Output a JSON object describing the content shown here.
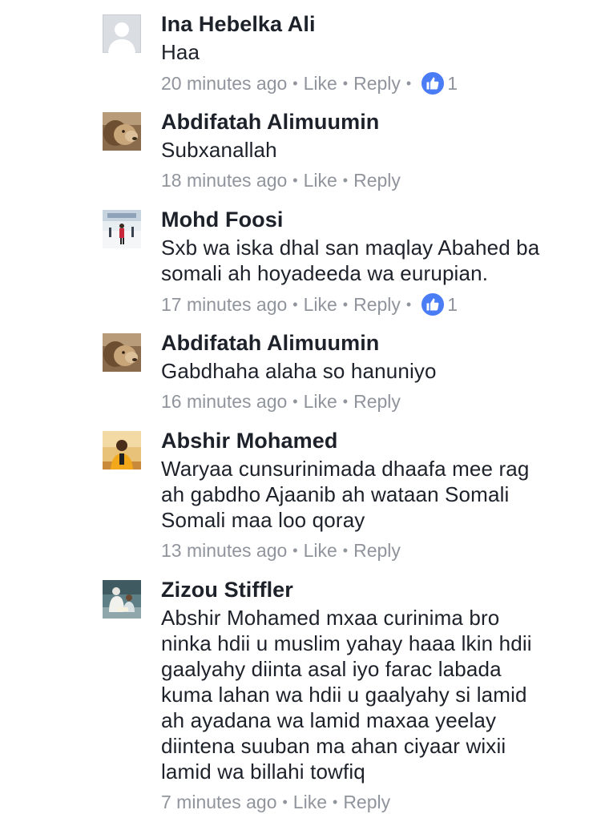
{
  "comments": [
    {
      "author": "Ina Hebelka Ali",
      "avatar": "default-profile-icon",
      "lines": [
        "Haa"
      ],
      "time": "20 minutes ago",
      "like_label": "Like",
      "reply_label": "Reply",
      "reaction_count": "1"
    },
    {
      "author": "Abdifatah Alimuumin",
      "avatar": "lion-photo",
      "lines": [
        "Subxanallah"
      ],
      "time": "18 minutes ago",
      "like_label": "Like",
      "reply_label": "Reply"
    },
    {
      "author": "Mohd Foosi",
      "avatar": "snow-street-photo",
      "lines": [
        "Sxb wa iska dhal san maqlay Abahed ba",
        "somali ah hoyadeeda wa eurupian."
      ],
      "time": "17 minutes ago",
      "like_label": "Like",
      "reply_label": "Reply",
      "reaction_count": "1"
    },
    {
      "author": "Abdifatah Alimuumin",
      "avatar": "lion-photo",
      "lines": [
        "Gabdhaha alaha so hanuniyo"
      ],
      "time": "16 minutes ago",
      "like_label": "Like",
      "reply_label": "Reply"
    },
    {
      "author": "Abshir Mohamed",
      "avatar": "portrait-photo",
      "lines": [
        "Waryaa cunsurinimada dhaafa mee rag",
        "ah gabdho Ajaanib ah wataan Somali",
        "Somali maa loo qoray"
      ],
      "time": "13 minutes ago",
      "like_label": "Like",
      "reply_label": "Reply"
    },
    {
      "author": "Zizou Stiffler",
      "avatar": "reading-photo",
      "lines": [
        "Abshir Mohamed mxaa curinima bro",
        "ninka hdii u muslim yahay haaa lkin hdii",
        "gaalyahy diinta asal iyo farac labada",
        "kuma lahan wa hdii u gaalyahy si lamid",
        "ah ayadana wa lamid maxaa yeelay",
        "diintena suuban ma ahan ciyaar wixii",
        "lamid wa billahi towfiq"
      ],
      "time": "7 minutes ago",
      "like_label": "Like",
      "reply_label": "Reply"
    }
  ],
  "colors": {
    "author": "#1d2129",
    "meta": "#90949c",
    "like_bubble": "#4a7cf5"
  }
}
